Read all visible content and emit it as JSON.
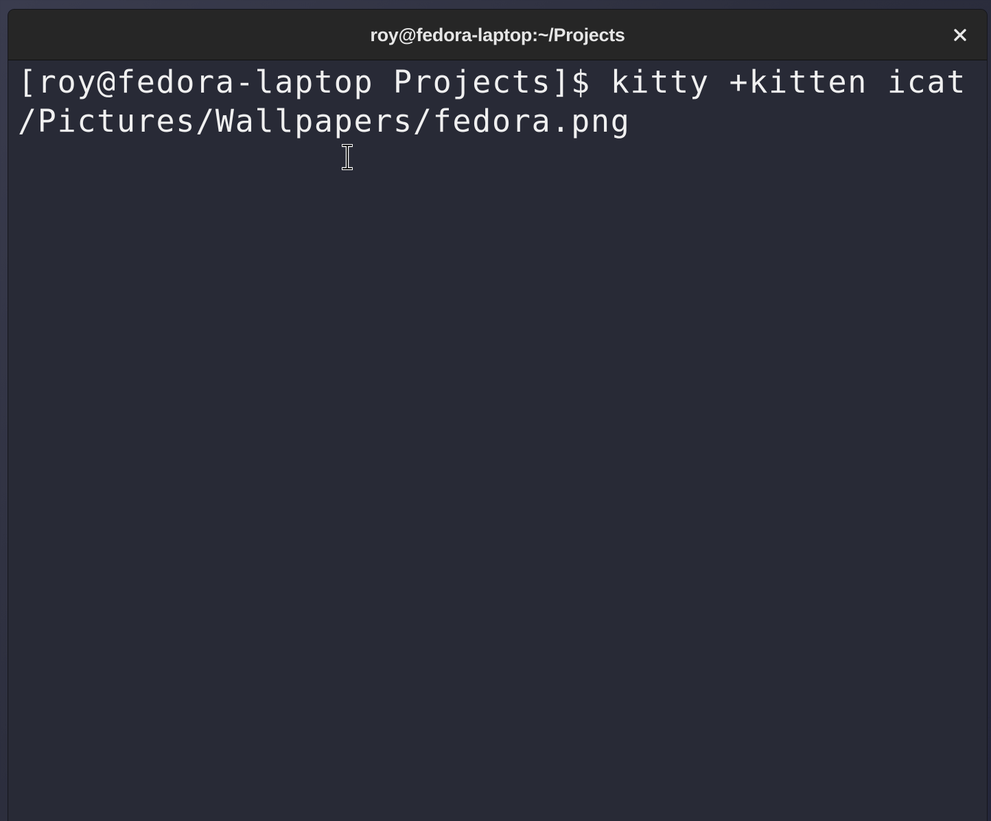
{
  "window": {
    "title": "roy@fedora-laptop:~/Projects"
  },
  "terminal": {
    "lines": [
      "[roy@fedora-laptop Projects]$ kitty +kitten icat ~",
      "/Pictures/Wallpapers/fedora.png"
    ]
  },
  "icons": {
    "close": "close-icon",
    "pointer": "text-cursor-icon"
  },
  "colors": {
    "terminal_bg": "#282a36",
    "titlebar_bg": "#262626",
    "text": "#f0f0f0"
  }
}
